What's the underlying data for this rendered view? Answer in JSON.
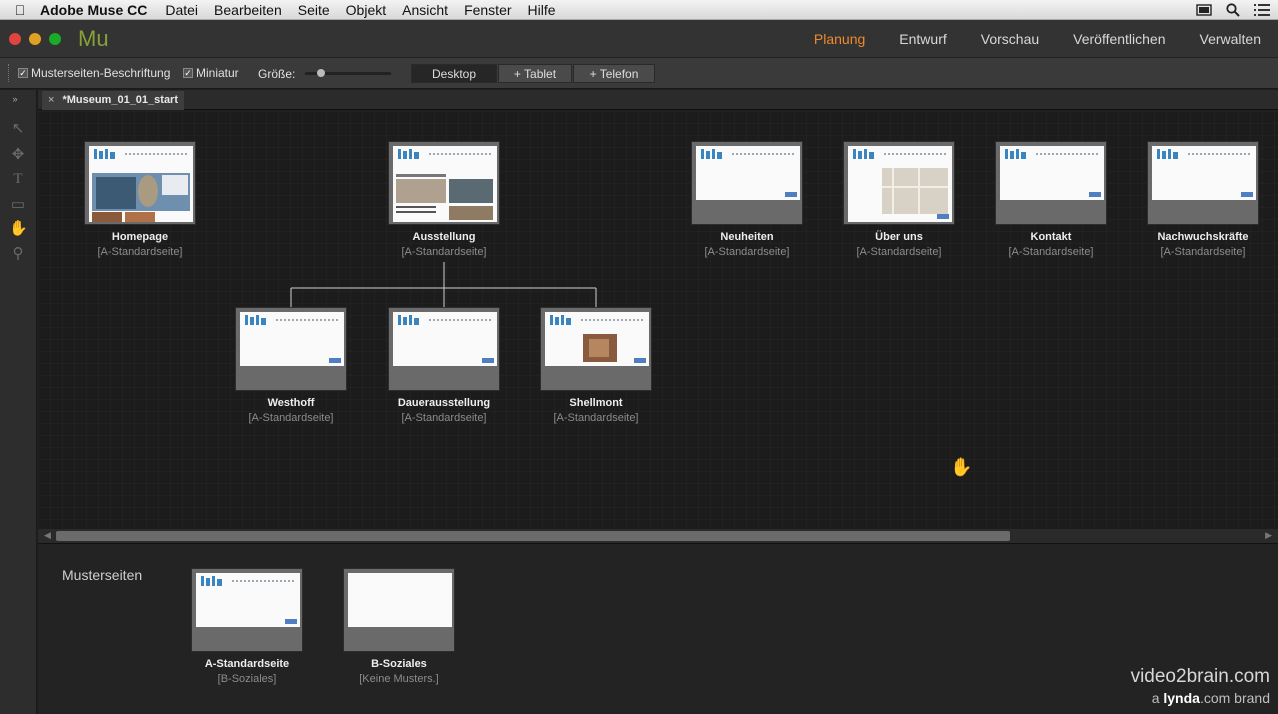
{
  "menubar": {
    "app": "Adobe Muse CC",
    "items": [
      "Datei",
      "Bearbeiten",
      "Seite",
      "Objekt",
      "Ansicht",
      "Fenster",
      "Hilfe"
    ]
  },
  "titlebar": {
    "logo": "Mu",
    "modes": [
      "Planung",
      "Entwurf",
      "Vorschau",
      "Veröffentlichen",
      "Verwalten"
    ],
    "active_mode": "Planung"
  },
  "options": {
    "master_labels": "Musterseiten-Beschriftung",
    "thumbnails": "Miniatur",
    "size_label": "Größe:",
    "size_level": 0.15,
    "devices": [
      "Desktop",
      "+ Tablet",
      "+ Telefon"
    ],
    "active_device": "Desktop"
  },
  "document": {
    "tab_title": "*Museum_01_01_start",
    "close": "×"
  },
  "sitemap": {
    "top": [
      {
        "name": "Homepage",
        "master": "[A-Standardseite]"
      },
      {
        "name": "Ausstellung",
        "master": "[A-Standardseite]"
      },
      {
        "name": "Neuheiten",
        "master": "[A-Standardseite]"
      },
      {
        "name": "Über uns",
        "master": "[A-Standardseite]"
      },
      {
        "name": "Kontakt",
        "master": "[A-Standardseite]"
      },
      {
        "name": "Nachwuchskräfte",
        "master": "[A-Standardseite]"
      }
    ],
    "children": [
      {
        "name": "Westhoff",
        "master": "[A-Standardseite]"
      },
      {
        "name": "Dauerausstellung",
        "master": "[A-Standardseite]"
      },
      {
        "name": "Shellmont",
        "master": "[A-Standardseite]"
      }
    ]
  },
  "masters": {
    "title": "Musterseiten",
    "items": [
      {
        "name": "A-Standardseite",
        "master": "[B-Soziales]"
      },
      {
        "name": "B-Soziales",
        "master": "[Keine Musters.]"
      }
    ]
  },
  "branding": {
    "line1": "video2brain.com",
    "line2a": "a ",
    "line2b": "lynda",
    "line2c": ".com brand"
  },
  "colors": {
    "active_mode": "#ef8a2c",
    "logo": "#87a138",
    "site_logo": "#3a84c0"
  }
}
